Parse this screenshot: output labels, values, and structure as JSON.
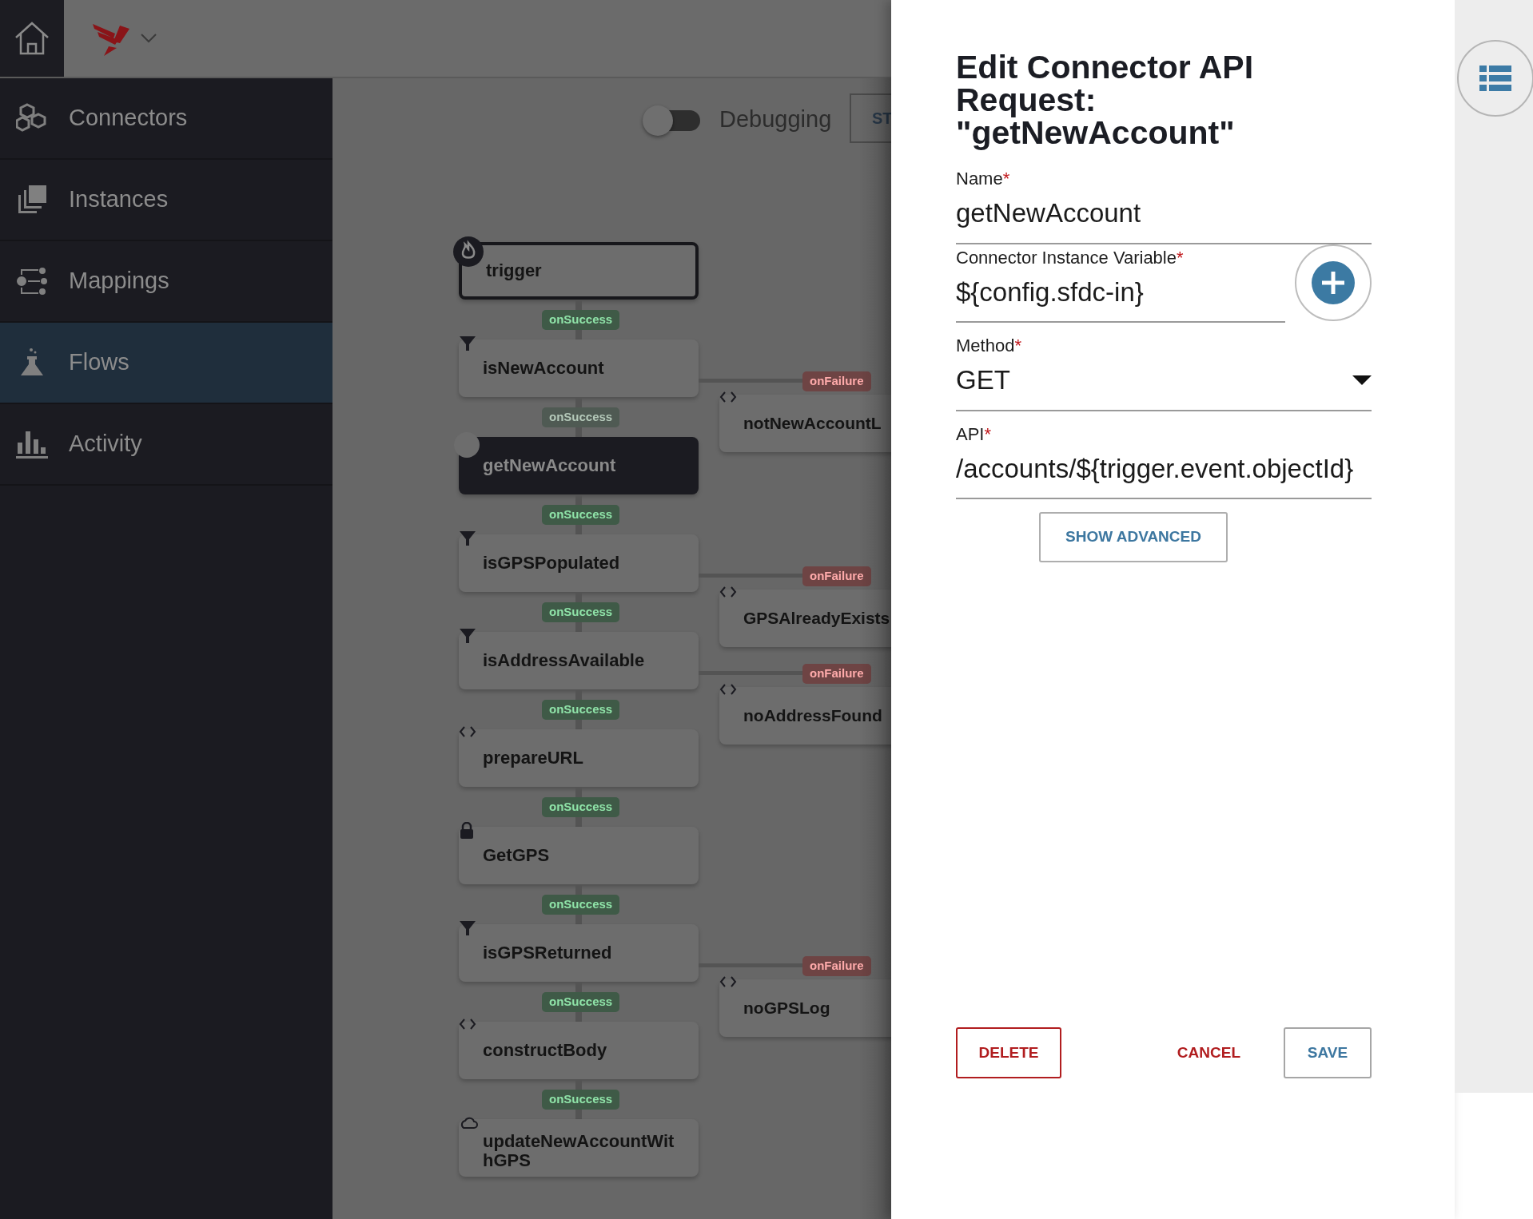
{
  "sidebar": {
    "items": [
      {
        "label": "Connectors",
        "selected": false
      },
      {
        "label": "Instances",
        "selected": false
      },
      {
        "label": "Mappings",
        "selected": false
      },
      {
        "label": "Flows",
        "selected": true
      },
      {
        "label": "Activity",
        "selected": false
      }
    ]
  },
  "toolbar": {
    "debugging": {
      "label": "Debugging",
      "on": false
    },
    "start_button": "ST"
  },
  "flow": {
    "steps": [
      {
        "name": "trigger",
        "kind": "trigger",
        "selected": false
      },
      {
        "name": "isNewAccount",
        "kind": "filter",
        "selected": false,
        "in_link": {
          "label": "onSuccess",
          "faded": false
        },
        "failure": {
          "label": "onFailure",
          "name": "notNewAccountL",
          "kind": "script"
        }
      },
      {
        "name": "getNewAccount",
        "kind": "request",
        "selected": true,
        "in_link": {
          "label": "onSuccess",
          "faded": true
        }
      },
      {
        "name": "isGPSPopulated",
        "kind": "filter",
        "selected": false,
        "in_link": {
          "label": "onSuccess",
          "faded": false
        },
        "failure": {
          "label": "onFailure",
          "name": "GPSAlreadyExists",
          "kind": "script"
        }
      },
      {
        "name": "isAddressAvailable",
        "kind": "filter",
        "selected": false,
        "in_link": {
          "label": "onSuccess",
          "faded": false
        },
        "failure": {
          "label": "onFailure",
          "name": "noAddressFound",
          "kind": "script"
        }
      },
      {
        "name": "prepareURL",
        "kind": "script",
        "selected": false,
        "in_link": {
          "label": "onSuccess",
          "faded": false
        }
      },
      {
        "name": "GetGPS",
        "kind": "lock",
        "selected": false,
        "in_link": {
          "label": "onSuccess",
          "faded": false
        }
      },
      {
        "name": "isGPSReturned",
        "kind": "filter",
        "selected": false,
        "in_link": {
          "label": "onSuccess",
          "faded": false
        },
        "failure": {
          "label": "onFailure",
          "name": "noGPSLog",
          "kind": "script"
        }
      },
      {
        "name": "constructBody",
        "kind": "script",
        "selected": false,
        "in_link": {
          "label": "onSuccess",
          "faded": false
        }
      },
      {
        "name": "updateNewAccountWithGPS",
        "kind": "cloud",
        "selected": false,
        "in_link": {
          "label": "onSuccess",
          "faded": false
        }
      }
    ]
  },
  "panel": {
    "title": "Edit Connector API Request: \"getNewAccount\"",
    "fields": [
      {
        "kind": "text",
        "label": "Name",
        "required_mark": "*",
        "value": "getNewAccount"
      },
      {
        "kind": "text_add",
        "label": "Connector Instance Variable",
        "required_mark": "*",
        "value": "${config.sfdc-in}"
      },
      {
        "kind": "select",
        "label": "Method",
        "required_mark": "*",
        "value": "GET"
      },
      {
        "kind": "text",
        "label": "API",
        "required_mark": "*",
        "value": "/accounts/${trigger.event.objectId}"
      }
    ],
    "advanced_button": "SHOW ADVANCED",
    "buttons": [
      {
        "label": "DELETE",
        "kind": "danger"
      },
      {
        "label": "CANCEL",
        "kind": "link"
      },
      {
        "label": "SAVE",
        "kind": "primary"
      }
    ]
  }
}
